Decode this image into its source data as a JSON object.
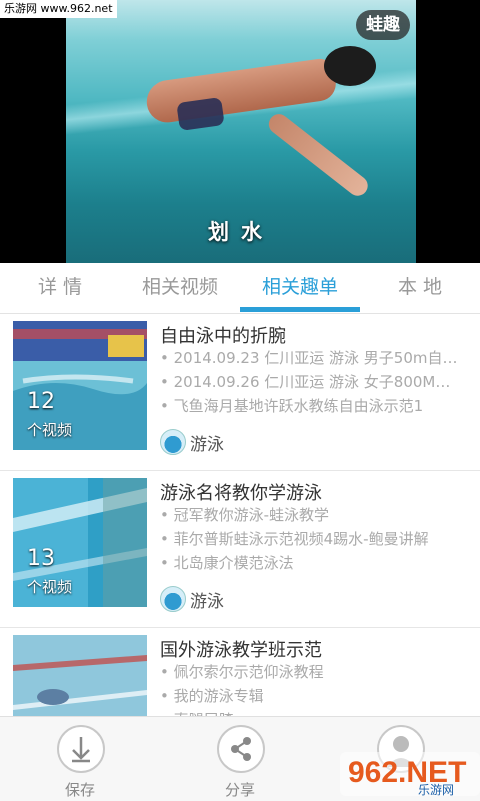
{
  "watermark_top": "乐游网 www.962.net",
  "video": {
    "badge": "蛙趣",
    "caption": "划水"
  },
  "tabs": [
    "详 情",
    "相关视频",
    "相关趣单",
    "本 地"
  ],
  "active_tab": "相关趣单",
  "items": [
    {
      "title": "自由泳中的折腕",
      "bullets": [
        "• 2014.09.23 仁川亚运 游泳 男子50m自…",
        "• 2014.09.26 仁川亚运 游泳 女子800M…",
        "• 飞鱼海月基地许跃水教练自由泳示范1"
      ],
      "count": "12",
      "count_label": "个视频",
      "tag": "游泳"
    },
    {
      "title": "游泳名将教你学游泳",
      "bullets": [
        "• 冠军教你游泳-蛙泳教学",
        "• 菲尔普斯蛙泳示范视频4踢水-鲍曼讲解",
        "• 北岛康介模范泳法"
      ],
      "count": "13",
      "count_label": "个视频",
      "tag": "游泳"
    },
    {
      "title": "国外游泳教学班示范",
      "bullets": [
        "• 佩尔索尔示范仰泳教程",
        "• 我的游泳专辑",
        "• 直腿屈膝"
      ],
      "count": "",
      "count_label": "",
      "tag": ""
    }
  ],
  "actions": {
    "save_label": "保存",
    "share_label": "分享"
  },
  "watermark_logo": {
    "text": "962.NET",
    "sub": "乐游网"
  },
  "colors": {
    "accent": "#2a9fd8",
    "inactive_tab": "#999999",
    "bullet": "#aaaaaa"
  }
}
